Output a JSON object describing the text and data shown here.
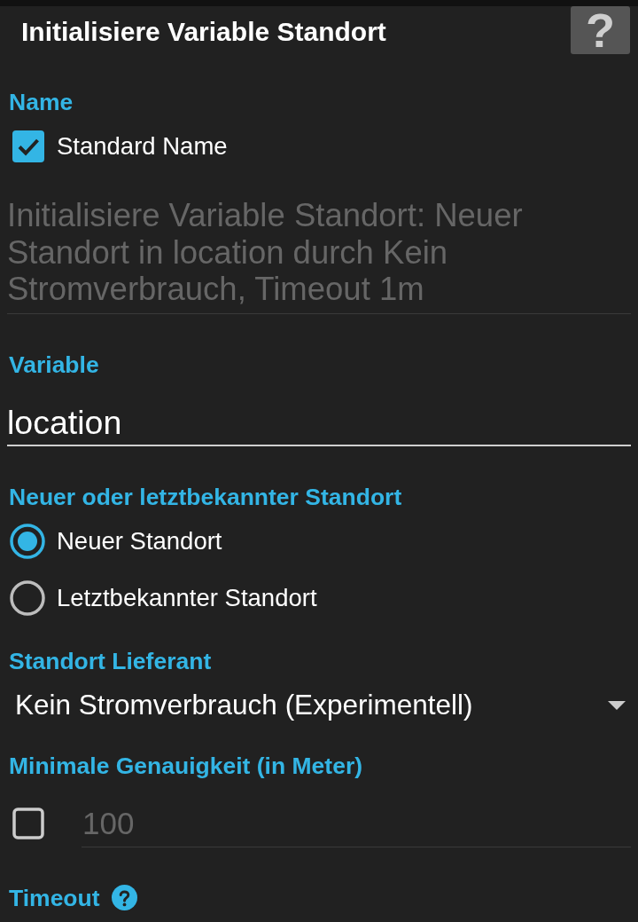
{
  "window": {
    "title": "Initialisiere Variable Standort",
    "help_button": {
      "label": "?"
    }
  },
  "sections": [
    {
      "label": "Name",
      "controls": [
        {
          "kind": "checkbox",
          "label": "Standard Name",
          "checked": true
        },
        {
          "kind": "field",
          "value": "Initialisiere Variable Standort: Neuer Standort in location durch Kein Stromverbrauch, Timeout 1m",
          "disabled": true
        }
      ]
    },
    {
      "label": "Variable",
      "controls": [
        {
          "kind": "field",
          "value": "location",
          "disabled": false
        }
      ]
    },
    {
      "label": "Neuer oder letztbekannter Standort",
      "controls": [
        {
          "kind": "radio",
          "label": "Neuer Standort",
          "selected": true
        },
        {
          "kind": "radio",
          "label": "Letztbekannter Standort",
          "selected": false
        }
      ]
    },
    {
      "label": "Standort Lieferant",
      "controls": [
        {
          "kind": "dropdown",
          "value": "Kein Stromverbrauch (Experimentell)"
        }
      ]
    },
    {
      "label": "Minimale Genauigkeit (in Meter)",
      "controls": [
        {
          "kind": "checkbox_field",
          "checked": false,
          "value": "100",
          "disabled": true
        }
      ]
    },
    {
      "label": "Timeout",
      "help": true
    }
  ]
}
